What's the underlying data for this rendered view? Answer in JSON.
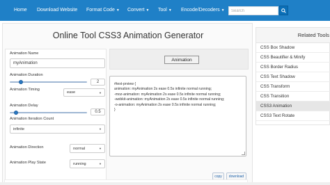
{
  "nav": {
    "items": [
      {
        "label": "Home",
        "has_caret": false
      },
      {
        "label": "Download Website",
        "has_caret": false
      },
      {
        "label": "Format Code",
        "has_caret": true
      },
      {
        "label": "Convert",
        "has_caret": true
      },
      {
        "label": "Tool",
        "has_caret": true
      },
      {
        "label": "Encode/Decoders",
        "has_caret": true
      }
    ],
    "caret": "▼",
    "search_placeholder": "Search",
    "search_icon": "search-icon"
  },
  "page_title": "Online Tool CSS3 Animation Generator",
  "form": {
    "name_label": "Animation Name",
    "name_value": "myAnimation",
    "duration_label": "Animation Duration",
    "duration_value": "2",
    "duration_slider_fraction": 0.12,
    "timing_label": "Animation Timing",
    "timing_value": "ease",
    "delay_label": "Animation Delay",
    "delay_value": "0.5",
    "delay_slider_fraction": 0.05,
    "iteration_label": "Animation Iteration Count",
    "iteration_value": "infinite",
    "direction_label": "Animation Direction",
    "direction_value": "normal",
    "play_state_label": "Animation Play State",
    "play_state_value": "running"
  },
  "preview": {
    "box_label": "Animation"
  },
  "code": {
    "lines": [
      "#text-prview {",
      "  animation: myAnimation 2s ease 0.5s infinite normal running;",
      "  -moz-animation: myAnimation 2s ease 0.5s infinite normal running;",
      "  -webkit-animation: myAnimation 2s ease 0.5s infinite normal running;",
      "  -o-animation: myAnimation 2s ease 0.5s infinite normal running;",
      "}"
    ]
  },
  "buttons": {
    "copy": "copy",
    "download": "download"
  },
  "sidebar": {
    "title": "Related Tools",
    "items": [
      {
        "label": "CSS Box Shadow",
        "active": false
      },
      {
        "label": "CSS Beautifier & Minify",
        "active": false
      },
      {
        "label": "CSS Border Radius",
        "active": false
      },
      {
        "label": "CSS Text Shadow",
        "active": false
      },
      {
        "label": "CSS Transform",
        "active": false
      },
      {
        "label": "CSS Transition",
        "active": false
      },
      {
        "label": "CSS3 Animation",
        "active": true
      },
      {
        "label": "CSS3 Text Rotate",
        "active": false
      }
    ]
  },
  "colors": {
    "nav_bg": "#1f80c7",
    "search_btn": "#0a6fb8",
    "slider_thumb": "#2a78c2"
  }
}
